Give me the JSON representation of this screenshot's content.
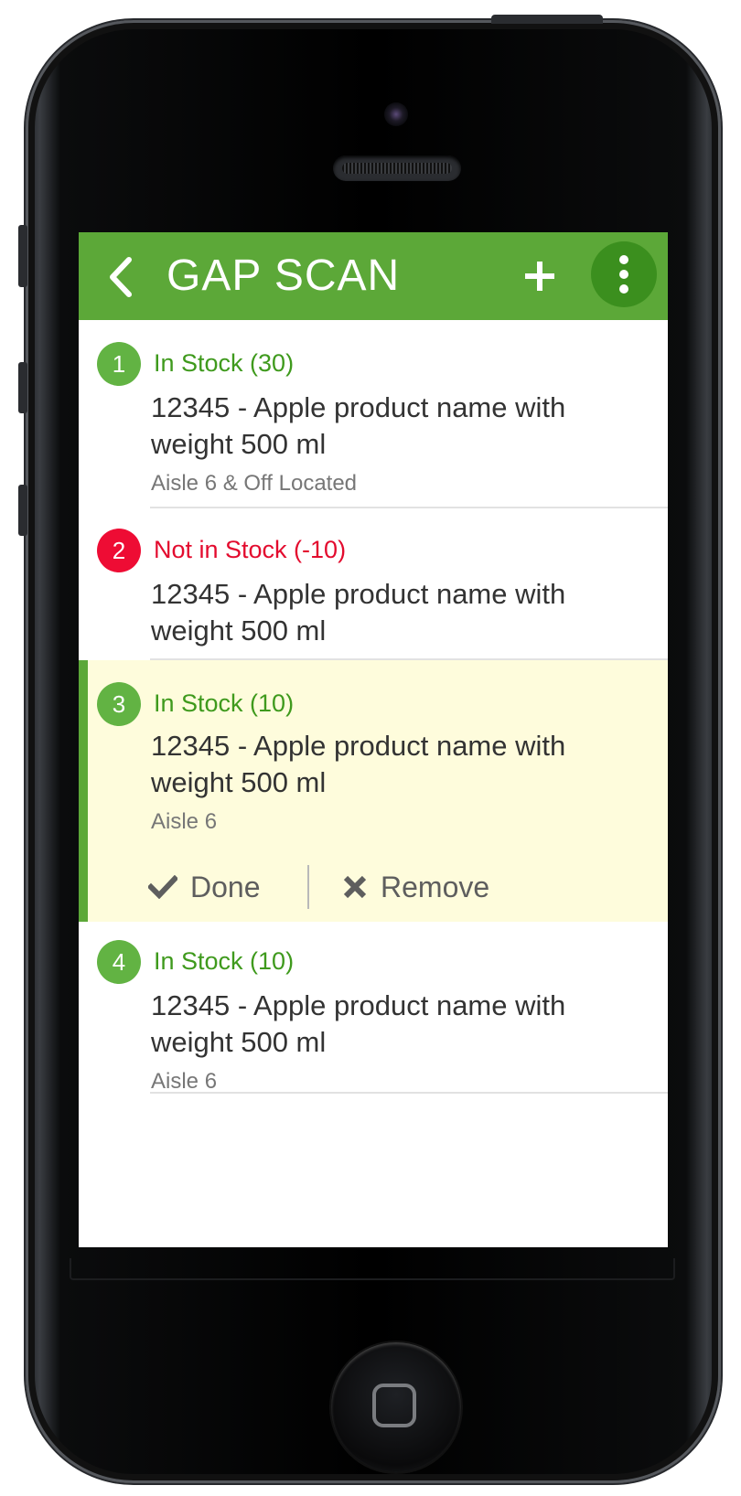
{
  "header": {
    "title": "GAP SCAN",
    "back_icon": "chevron-left-icon",
    "add_icon": "plus-icon",
    "menu_icon": "more-vertical-icon"
  },
  "colors": {
    "app_bar": "#5ca838",
    "in_stock": "#3f9a1d",
    "not_in_stock": "#e30b2e",
    "selected_row": "#fefcdc"
  },
  "items": [
    {
      "number": "1",
      "status": "In Stock (30)",
      "status_type": "in-stock",
      "name": "12345 - Apple product name with weight 500 ml",
      "location": "Aisle 6 & Off Located"
    },
    {
      "number": "2",
      "status": "Not in Stock (-10)",
      "status_type": "not-in-stock",
      "name": "12345 - Apple product name with weight 500 ml",
      "location": ""
    },
    {
      "number": "3",
      "status": "In Stock (10)",
      "status_type": "in-stock",
      "name": "12345 - Apple product name with weight 500 ml",
      "location": "Aisle 6",
      "selected": true
    },
    {
      "number": "4",
      "status": "In Stock (10)",
      "status_type": "in-stock",
      "name": "12345 - Apple product name with weight 500 ml",
      "location": "Aisle 6"
    }
  ],
  "actions": {
    "done_label": "Done",
    "done_icon": "checkmark-icon",
    "remove_label": "Remove",
    "remove_icon": "close-icon"
  }
}
